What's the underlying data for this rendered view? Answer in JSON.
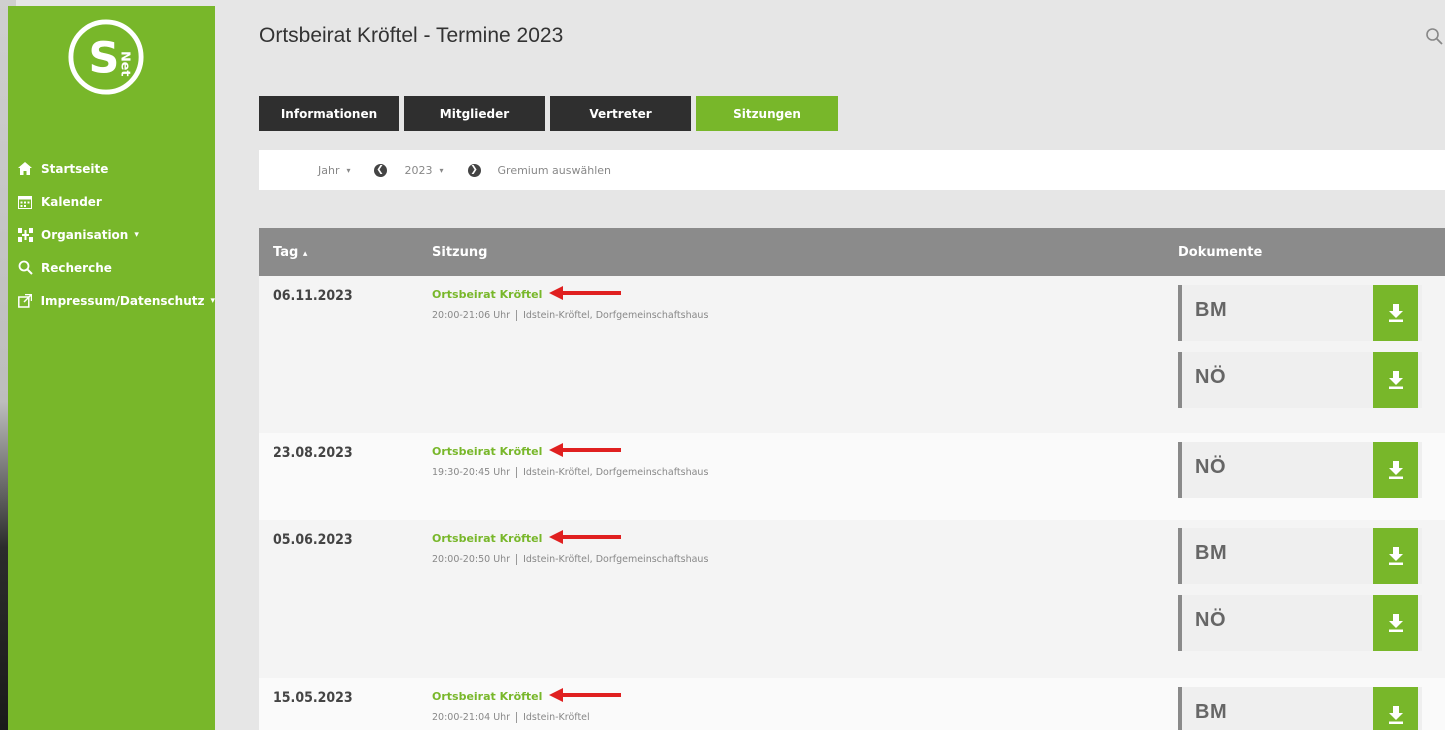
{
  "sidebar": {
    "logo_text": "Net",
    "items": [
      {
        "label": "Startseite",
        "icon": "home-icon"
      },
      {
        "label": "Kalender",
        "icon": "calendar-icon"
      },
      {
        "label": "Organisation",
        "icon": "org-chart-icon",
        "caret": "▾"
      },
      {
        "label": "Recherche",
        "icon": "search-icon"
      },
      {
        "label": "Impressum/Datenschutz",
        "icon": "external-link-icon",
        "caret": "▾"
      }
    ]
  },
  "header": {
    "title": "Ortsbeirat Kröftel - Termine 2023"
  },
  "tabs": [
    {
      "label": "Informationen",
      "active": false
    },
    {
      "label": "Mitglieder",
      "active": false
    },
    {
      "label": "Vertreter",
      "active": false
    },
    {
      "label": "Sitzungen",
      "active": true
    }
  ],
  "filter": {
    "period_label": "Jahr",
    "period_caret": "▾",
    "year": "2023",
    "year_caret": "▾",
    "prev_symbol": "❮",
    "next_symbol": "❯",
    "gremium": "Gremium auswählen"
  },
  "table": {
    "col_day": "Tag",
    "col_day_sort": "▴",
    "col_session": "Sitzung",
    "col_docs": "Dokumente"
  },
  "rows": [
    {
      "date": "06.11.2023",
      "title": "Ortsbeirat Kröftel",
      "time": "20:00-21:06 Uhr",
      "place": "Idstein-Kröftel, Dorfgemeinschaftshaus",
      "docs": [
        "BM",
        "NÖ"
      ]
    },
    {
      "date": "23.08.2023",
      "title": "Ortsbeirat Kröftel",
      "time": "19:30-20:45 Uhr",
      "place": "Idstein-Kröftel, Dorfgemeinschaftshaus",
      "docs": [
        "NÖ"
      ]
    },
    {
      "date": "05.06.2023",
      "title": "Ortsbeirat Kröftel",
      "time": "20:00-20:50 Uhr",
      "place": "Idstein-Kröftel, Dorfgemeinschaftshaus",
      "docs": [
        "BM",
        "NÖ"
      ]
    },
    {
      "date": "15.05.2023",
      "title": "Ortsbeirat Kröftel",
      "time": "20:00-21:04 Uhr",
      "place": "Idstein-Kröftel",
      "docs": [
        "BM"
      ]
    }
  ],
  "colors": {
    "accent": "#78b72a",
    "tab_dark": "#2f2f2f",
    "table_header": "#8b8b8b",
    "annotation_arrow": "#e02020"
  }
}
